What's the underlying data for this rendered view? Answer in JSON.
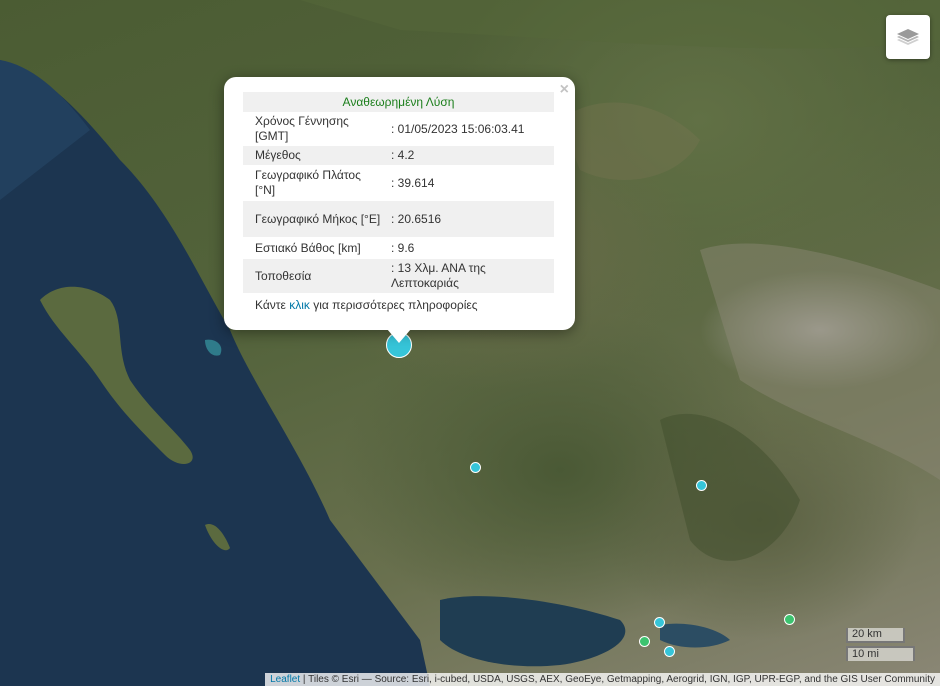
{
  "map": {
    "layers_control_icon": "layers-icon",
    "popup": {
      "title": "Αναθεωρημένη Λύση",
      "close_label": "×",
      "rows": [
        {
          "label": "Χρόνος Γέννησης [GMT]",
          "value": ": 01/05/2023 15:06:03.41"
        },
        {
          "label": "Μέγεθος",
          "value": ": 4.2"
        },
        {
          "label": "Γεωγραφικό Πλάτος [°N]",
          "value": ": 39.614"
        },
        {
          "label": "Γεωγραφικό Μήκος [°E]",
          "value": ": 20.6516"
        },
        {
          "label": "Εστιακό Βάθος [km]",
          "value": ": 9.6"
        },
        {
          "label": "Τοποθεσία",
          "value": ": 13 Χλμ. ΑΝΑ της Λεπτοκαριάς"
        }
      ],
      "more_prefix": "Κάντε ",
      "more_link": "κλικ",
      "more_suffix": " για περισσότερες πληροφορίες"
    },
    "scale": {
      "metric": "20 km",
      "imperial": "10 mi"
    },
    "attribution": {
      "leaflet": "Leaflet",
      "text": " | Tiles © Esri — Source: Esri, i-cubed, USDA, USGS, AEX, GeoEye, Getmapping, Aerogrid, IGN, IGP, UPR-EGP, and the GIS User Community"
    },
    "colors": {
      "marker_cyan": "#36c5d9",
      "marker_green": "#3cc36f",
      "popup_title": "#1b7e1b",
      "link": "#0078a8"
    }
  }
}
